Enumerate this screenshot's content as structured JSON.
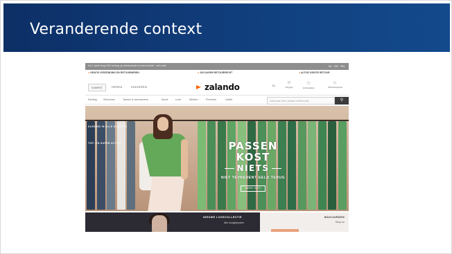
{
  "slide": {
    "title": "Veranderende context"
  },
  "shot": {
    "topstrip": {
      "text": "Nu 1 week lang 15% korting op damesmode en herenmode · met code",
      "lang": "NL · DE · EN"
    },
    "promos": [
      "GRATIS VERZENDING EN RETOURNEREN",
      "100 DAGEN RETOURRECHT",
      "ALTIJD GRATIS RETOUR"
    ],
    "nav": {
      "genders": [
        "DAMES",
        "HEREN",
        "KINDEREN"
      ],
      "logo": "zalando",
      "icons": [
        {
          "icon": "user-icon",
          "label": "Inloggen"
        },
        {
          "icon": "star-icon",
          "label": "Verlanglijstje"
        },
        {
          "icon": "bag-icon",
          "label": "Winkelwagentje"
        }
      ],
      "lang_small": "NL"
    },
    "categories": [
      "Kleding",
      "Schoenen",
      "Tassen & accessoires",
      "Sport",
      "Luxe",
      "Merken",
      "Premium",
      "Outlet"
    ],
    "search": {
      "placeholder": "Zoek naar merk, product of kleurcode",
      "button": "search-icon"
    },
    "hero": {
      "side_links": [
        "KLEDING IN ALLE KLEUREN",
        "TOP- EN SUPER ACTIES"
      ],
      "headline1": "PASSEN KOST",
      "headline2": "NIETS",
      "subline": "NIET TEVREDEN? GELD TERUG",
      "cta": "MEER INFO"
    },
    "lower": {
      "left_title": "NIEUWE LUXECOLLECTIE",
      "left_sub": "Alle hoogtepunten",
      "right_title": "MAXIJURKEN",
      "right_sub": "Shop nu"
    }
  },
  "colors": {
    "title_bar": "#11407f",
    "accent": "#ff6900"
  }
}
